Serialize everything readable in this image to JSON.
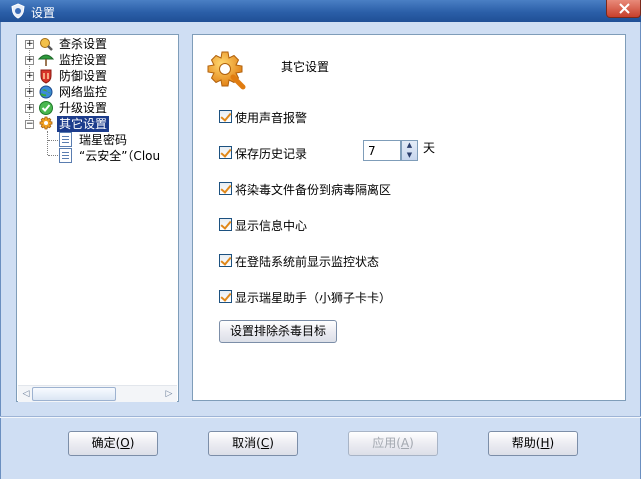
{
  "window": {
    "title": "设置"
  },
  "tree": {
    "items": [
      {
        "label": "查杀设置",
        "icon": "scan-icon",
        "expander": "+"
      },
      {
        "label": "监控设置",
        "icon": "monitor-icon",
        "expander": "+"
      },
      {
        "label": "防御设置",
        "icon": "defense-icon",
        "expander": "+"
      },
      {
        "label": "网络监控",
        "icon": "network-icon",
        "expander": "+"
      },
      {
        "label": "升级设置",
        "icon": "upgrade-icon",
        "expander": "+"
      },
      {
        "label": "其它设置",
        "icon": "gear-icon",
        "expander": "−",
        "selected": true
      }
    ],
    "children": [
      {
        "label": "瑞星密码"
      },
      {
        "label": "“云安全”（Clou"
      }
    ]
  },
  "content": {
    "section_title": "其它设置",
    "options": [
      {
        "label": "使用声音报警",
        "checked": true
      },
      {
        "label": "保存历史记录",
        "checked": true
      },
      {
        "label": "将染毒文件备份到病毒隔离区",
        "checked": true
      },
      {
        "label": "显示信息中心",
        "checked": true
      },
      {
        "label": "在登陆系统前显示监控状态",
        "checked": true
      },
      {
        "label": "显示瑞星助手（小狮子卡卡）",
        "checked": true
      }
    ],
    "history_days": "7",
    "history_unit": "天",
    "exclude_button": "设置排除杀毒目标"
  },
  "footer": {
    "ok": "确定",
    "ok_key": "O",
    "cancel": "取消",
    "cancel_key": "C",
    "apply": "应用",
    "apply_key": "A",
    "help": "帮助",
    "help_key": "H"
  },
  "colors": {
    "title_bar": "#2b5fa8",
    "background": "#cfdef3",
    "selected": "#1c3c8c",
    "check_mark": "#e0881a"
  }
}
